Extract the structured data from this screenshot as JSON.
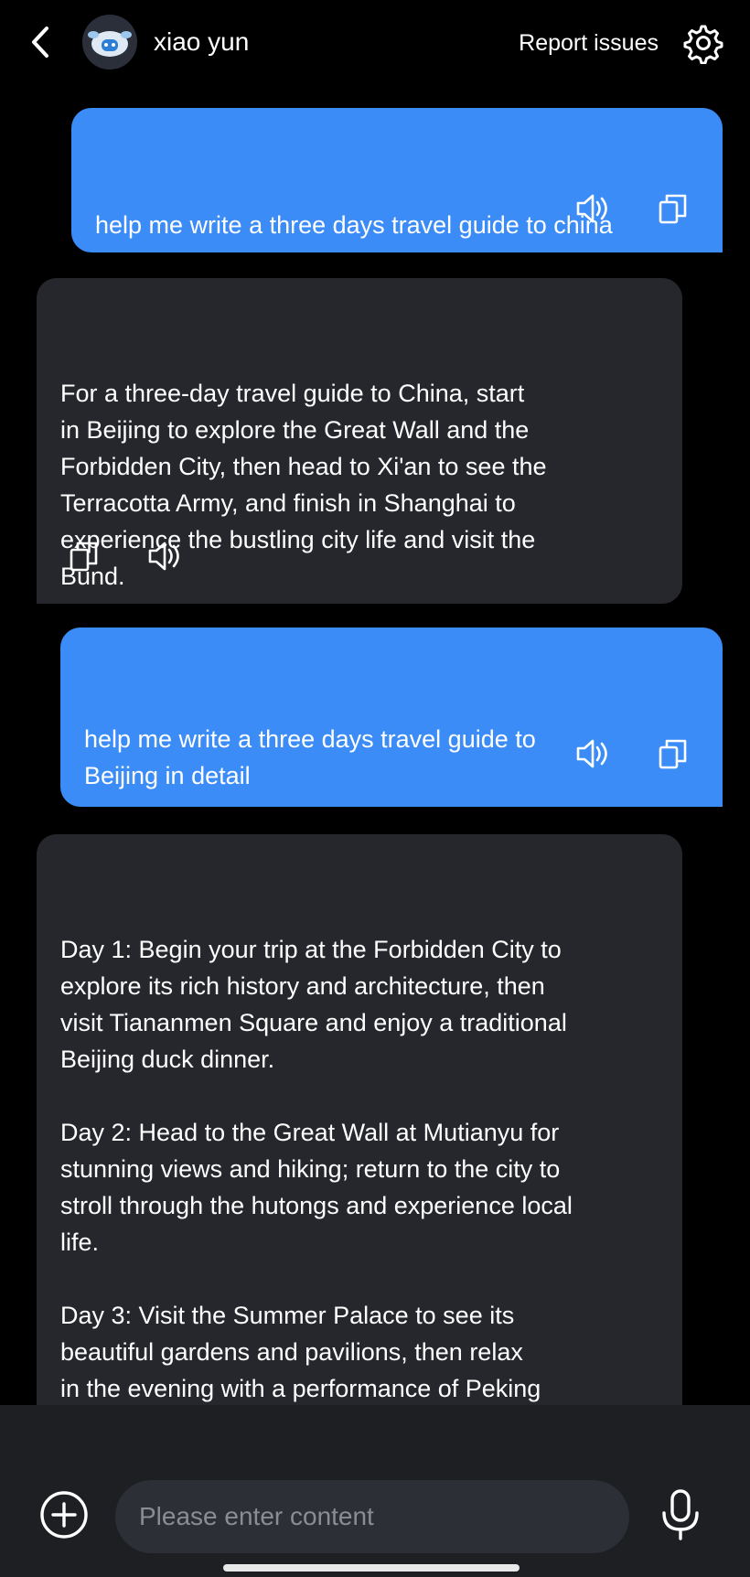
{
  "header": {
    "title": "xiao yun",
    "report_label": "Report issues",
    "icons": {
      "back": "chevron-left-icon",
      "avatar": "bot-avatar",
      "settings": "gear-icon"
    }
  },
  "messages": [
    {
      "role": "user",
      "text": "help me write a three days travel guide to china",
      "actions": [
        "speaker-icon",
        "copy-icon"
      ]
    },
    {
      "role": "assistant",
      "text": "For a three-day travel guide to China, start\nin Beijing to explore the Great Wall and the\nForbidden City, then head to Xi'an to see the\nTerracotta Army, and finish in Shanghai to\nexperience the bustling city life and visit the\nBund.",
      "actions": [
        "copy-icon",
        "speaker-icon"
      ]
    },
    {
      "role": "user",
      "text": "help me write a three days travel guide to\nBeijing in detail",
      "actions": [
        "speaker-icon",
        "copy-icon"
      ]
    },
    {
      "role": "assistant",
      "text": "Day 1: Begin your trip at the Forbidden City to\nexplore its rich history and architecture, then\nvisit Tiananmen Square and enjoy a traditional\nBeijing duck dinner.\n\nDay 2: Head to the Great Wall at Mutianyu for\nstunning views and hiking; return to the city to\nstroll through the hutongs and experience local\nlife.\n\nDay 3: Visit the Summer Palace to see its\nbeautiful gardens and pavilions, then relax\nin the evening with a performance of Peking\nOpera."
    }
  ],
  "composer": {
    "placeholder": "Please enter content",
    "value": "",
    "icons": {
      "add": "plus-circle-icon",
      "mic": "microphone-icon"
    }
  },
  "colors": {
    "background": "#000000",
    "user_bubble": "#3b8cf7",
    "bot_bubble": "#25272d",
    "composer_bar": "#1d1f23"
  }
}
